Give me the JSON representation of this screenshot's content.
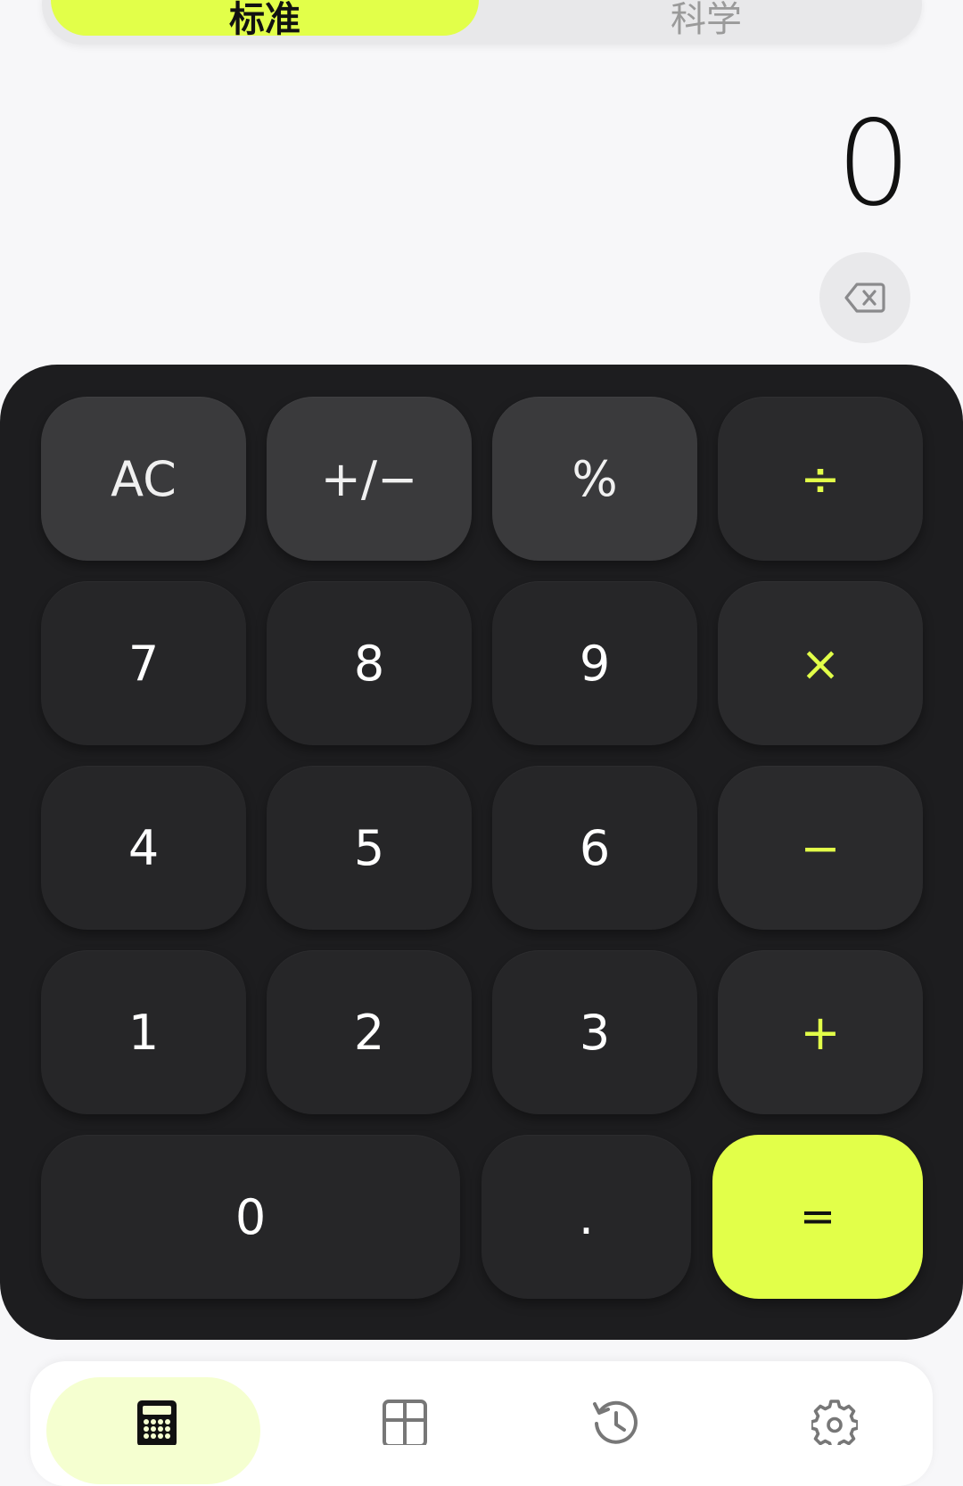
{
  "tabs": {
    "standard_label": "标准",
    "scientific_label": "科学"
  },
  "display": {
    "value": "0"
  },
  "keys": {
    "ac": "AC",
    "sign": "+/−",
    "percent": "%",
    "divide": "÷",
    "seven": "7",
    "eight": "8",
    "nine": "9",
    "multiply": "×",
    "four": "4",
    "five": "5",
    "six": "6",
    "minus": "−",
    "one": "1",
    "two": "2",
    "three": "3",
    "plus": "+",
    "zero": "0",
    "dot": ".",
    "equals": "="
  },
  "icons": {
    "backspace": "backspace-icon",
    "calculator": "calculator-icon",
    "grid": "grid-icon",
    "history": "history-icon",
    "settings": "gear-icon"
  },
  "colors": {
    "accent": "#e2ff49",
    "keypad_bg": "#1d1d1f",
    "key_bg": "#262628",
    "fn_key_bg": "#3a3a3c"
  }
}
